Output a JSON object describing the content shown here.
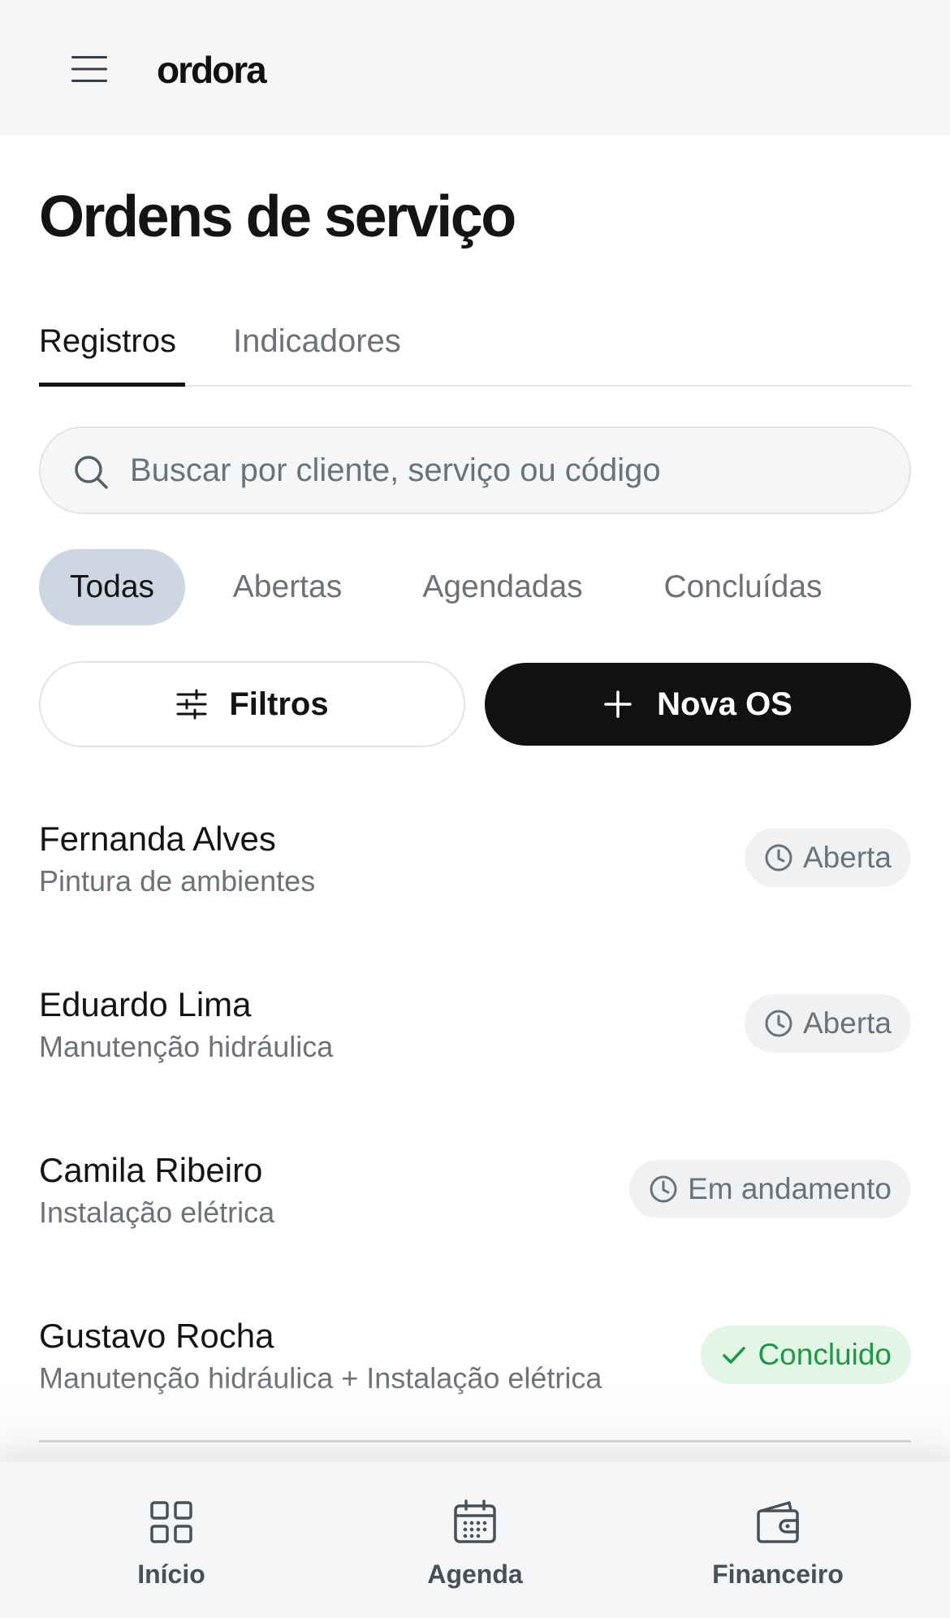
{
  "header": {
    "logo": "ordora",
    "menu_icon": "hamburger-icon"
  },
  "page": {
    "title": "Ordens de serviço"
  },
  "tabs": [
    {
      "label": "Registros",
      "active": true
    },
    {
      "label": "Indicadores",
      "active": false
    }
  ],
  "search": {
    "placeholder": "Buscar por cliente, serviço ou código",
    "value": ""
  },
  "filters": [
    {
      "label": "Todas",
      "selected": true
    },
    {
      "label": "Abertas",
      "selected": false
    },
    {
      "label": "Agendadas",
      "selected": false
    },
    {
      "label": "Concluídas",
      "selected": false
    }
  ],
  "actions": {
    "filter_label": "Filtros",
    "new_label": "Nova OS"
  },
  "orders": [
    {
      "client": "Fernanda Alves",
      "service": "Pintura de ambientes",
      "status": "Aberta",
      "status_icon": "clock-icon"
    },
    {
      "client": "Eduardo Lima",
      "service": "Manutenção hidráulica",
      "status": "Aberta",
      "status_icon": "clock-icon"
    },
    {
      "client": "Camila Ribeiro",
      "service": "Instalação elétrica",
      "status": "Em andamento",
      "status_icon": "clock-icon"
    },
    {
      "client": "Gustavo Rocha",
      "service": "Manutenção hidráulica + Instalação elétrica",
      "status": "Concluido",
      "status_icon": "check-icon"
    }
  ],
  "bottom_nav": [
    {
      "label": "Início",
      "icon": "grid-icon"
    },
    {
      "label": "Agenda",
      "icon": "calendar-icon"
    },
    {
      "label": "Financeiro",
      "icon": "wallet-icon"
    }
  ],
  "colors": {
    "accent_chip": "#cdd7e3",
    "primary_button": "#111111",
    "done_badge_bg": "#e3f6e6",
    "done_badge_text": "#1a9a45",
    "muted_text": "#6d7278"
  }
}
